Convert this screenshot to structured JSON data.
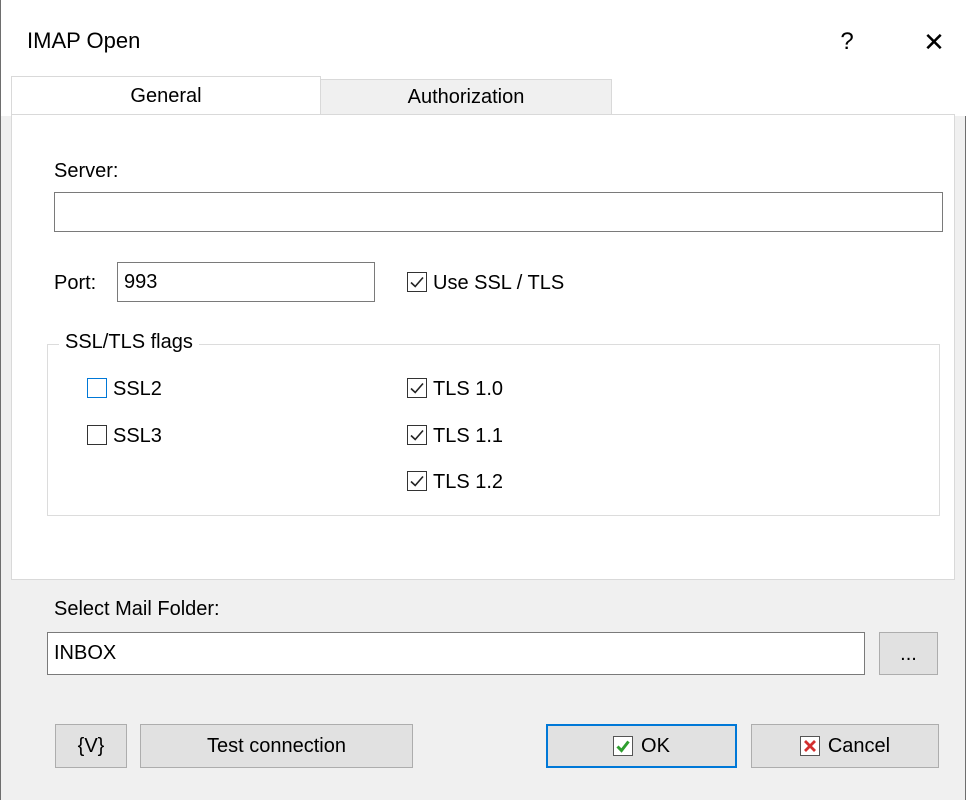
{
  "window": {
    "title": "IMAP Open",
    "help_label": "?",
    "close_label": "✕"
  },
  "tabs": [
    {
      "label": "General",
      "active": true
    },
    {
      "label": "Authorization",
      "active": false
    }
  ],
  "general": {
    "server_label": "Server:",
    "server_value": "",
    "port_label": "Port:",
    "port_value": "993",
    "use_ssl_label": "Use SSL / TLS",
    "use_ssl_checked": true,
    "flags_group_label": "SSL/TLS flags",
    "flags": [
      {
        "label": "SSL2",
        "checked": false
      },
      {
        "label": "SSL3",
        "checked": false
      },
      {
        "label": "TLS 1.0",
        "checked": true
      },
      {
        "label": "TLS 1.1",
        "checked": true
      },
      {
        "label": "TLS 1.2",
        "checked": true
      }
    ]
  },
  "mail_folder": {
    "label": "Select Mail Folder:",
    "value": "INBOX",
    "browse_label": "..."
  },
  "buttons": {
    "variables_label": "{V}",
    "test_label": "Test connection",
    "ok_label": "OK",
    "cancel_label": "Cancel"
  },
  "colors": {
    "accent": "#0078d7",
    "ok_check": "#2f9e2f",
    "cancel_x": "#d32f2f"
  }
}
